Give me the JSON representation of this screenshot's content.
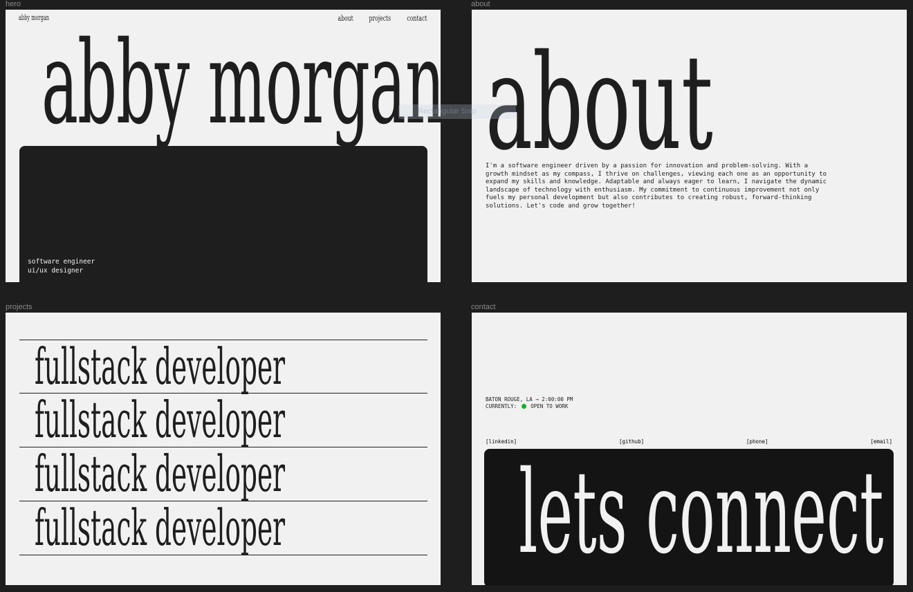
{
  "frames": {
    "hero": "hero",
    "about": "about",
    "projects": "projects",
    "contact": "contact"
  },
  "hero": {
    "brand": "abby morgan",
    "nav": [
      "about",
      "projects",
      "contact"
    ],
    "title": "abby morgan",
    "roles": [
      "software engineer",
      "ui/ux designer"
    ]
  },
  "about": {
    "title": "about",
    "lines": [
      "I'm a software engineer driven by a passion for innovation and  problem-solving. With a",
      "growth mindset as my compass, I thrive on  challenges, viewing each one as an opportunity to",
      "expand my skills and  knowledge. Adaptable and always eager to learn, I navigate the dynamic",
      "landscape of technology with enthusiasm. My commitment to continuous  improvement not only",
      "fuels my personal development but also contributes  to creating robust, forward-thinking",
      "solutions. Let's code and grow  together!"
    ]
  },
  "drag_chip": "Rectangular Snip",
  "projects": {
    "items": [
      "fullstack developer",
      "fullstack developer",
      "fullstack developer",
      "fullstack developer"
    ]
  },
  "contact": {
    "location": "BATON ROUGE, LA → 2:00:00 PM",
    "status_prefix": "CURRENTLY:",
    "status": "OPEN TO WORK",
    "status_color": "#22a82f",
    "links": [
      "[linkedin]",
      "[github]",
      "[phone]",
      "[email]"
    ],
    "cta": "lets connect"
  }
}
